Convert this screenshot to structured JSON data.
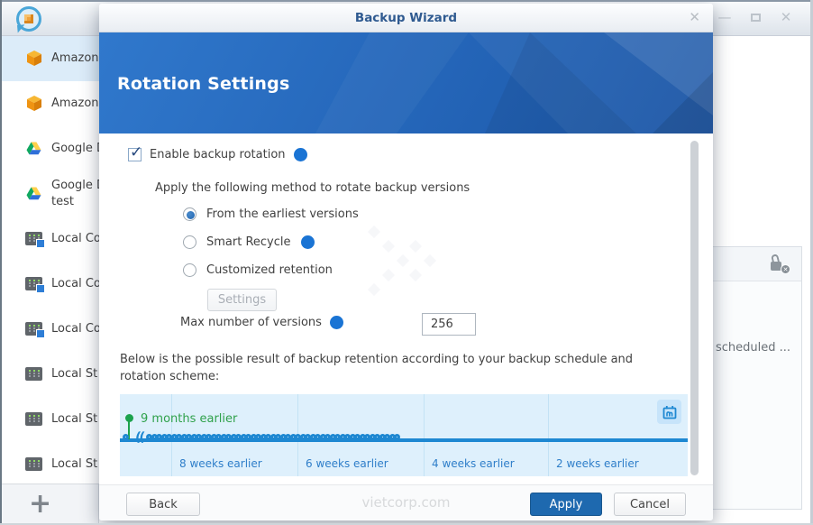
{
  "window": {
    "logo": "backup-app-logo",
    "controls": {
      "minimize": "—",
      "close": "✕"
    },
    "watermark": "vietcorp.com"
  },
  "sidebar": {
    "items": [
      {
        "label": "Amazon",
        "icon": "amazon-cube",
        "selected": true
      },
      {
        "label": "Amazon",
        "icon": "amazon-cube",
        "selected": false
      },
      {
        "label": "Google D",
        "icon": "google-drive",
        "selected": false
      },
      {
        "label": "Google D",
        "sublabel": "test",
        "icon": "google-drive",
        "selected": false
      },
      {
        "label": "Local Co",
        "icon": "nas-linked",
        "selected": false
      },
      {
        "label": "Local Co",
        "icon": "nas-linked",
        "selected": false
      },
      {
        "label": "Local Co",
        "icon": "nas-linked",
        "selected": false
      },
      {
        "label": "Local St",
        "icon": "nas",
        "selected": false
      },
      {
        "label": "Local St",
        "icon": "nas",
        "selected": false
      },
      {
        "label": "Local St",
        "icon": "nas",
        "selected": false
      }
    ],
    "add_button": "+"
  },
  "background_panel": {
    "header_icon": "lock-x",
    "status_text": "scheduled ..."
  },
  "dialog": {
    "title": "Backup Wizard",
    "close_icon": "✕",
    "header_title": "Rotation Settings",
    "form": {
      "enable_label": "Enable backup rotation",
      "enable_checked": true,
      "method_label": "Apply the following method to rotate backup versions",
      "radios": [
        {
          "label": "From the earliest versions",
          "selected": true,
          "has_info": false
        },
        {
          "label": "Smart Recycle",
          "selected": false,
          "has_info": true
        },
        {
          "label": "Customized retention",
          "selected": false,
          "has_info": false
        }
      ],
      "settings_button": "Settings",
      "settings_enabled": false,
      "max_versions_label": "Max number of versions",
      "max_versions_value": "256",
      "description_line": "Below is the possible result of backup retention according to your backup schedule and rotation scheme:"
    },
    "timeline": {
      "start_label": "9 months earlier",
      "section_labels": [
        "",
        "8 weeks earlier",
        "6 weeks earlier",
        "4 weeks earlier",
        "2 weeks earlier"
      ],
      "version_count": 51,
      "break_mark": "((",
      "calendar_icon": "calendar"
    },
    "footer": {
      "back_label": "Back",
      "apply_label": "Apply",
      "cancel_label": "Cancel"
    }
  },
  "colors": {
    "accent_blue": "#1e69af",
    "header_blue": "#2465b8",
    "timeline_blue": "#1e88d2",
    "retention_green": "#1ca24d",
    "selected_item_bg": "#dcecf9"
  }
}
